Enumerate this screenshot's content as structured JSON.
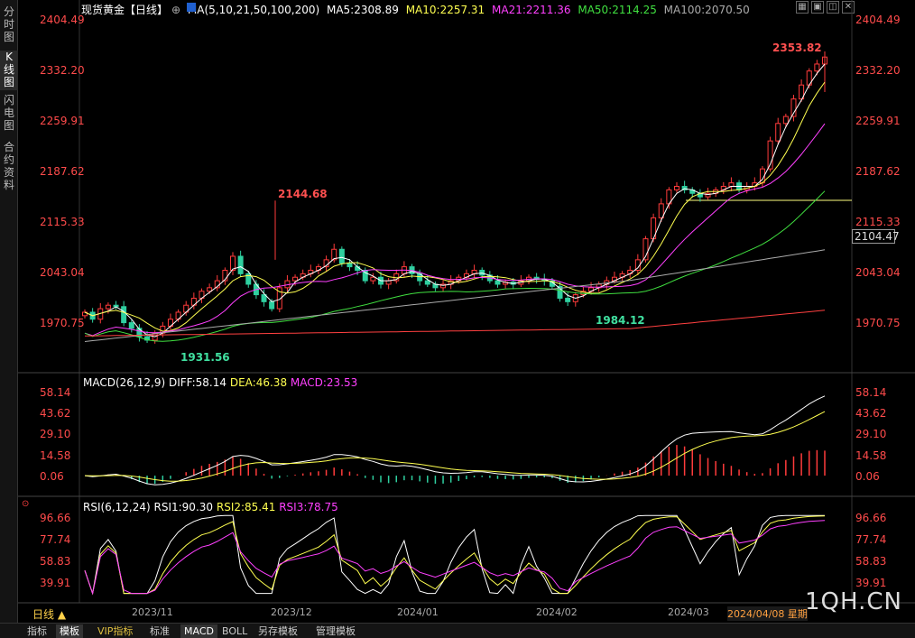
{
  "left_tabs": [
    {
      "label": "分\n时\n图",
      "active": false
    },
    {
      "label": "K\n线\n图",
      "active": true
    },
    {
      "label": "闪\n电\n图",
      "active": false
    },
    {
      "label": "合\n约\n资\n料",
      "active": false
    }
  ],
  "header": {
    "title": "现货黄金【日线】",
    "ma_params": "MA(5,10,21,50,100,200)",
    "ma5": "MA5:2308.89",
    "ma10": "MA10:2257.31",
    "ma21": "MA21:2211.36",
    "ma50": "MA50:2114.25",
    "ma100": "MA100:2070.50"
  },
  "colors": {
    "up": "#ff3b3b",
    "down": "#2fd0a0",
    "ma5": "#ffffff",
    "ma10": "#ffff50",
    "ma21": "#ff40ff",
    "ma50": "#40e040",
    "ma100": "#aaaaaa",
    "ma200": "#ff4040",
    "hline": "#ffff80"
  },
  "price_axis": [
    "2404.49",
    "2332.20",
    "2259.91",
    "2187.62",
    "2115.33",
    "2043.04",
    "1970.75"
  ],
  "current_price": "2104.47",
  "annotations": {
    "high1": "2144.68",
    "low1": "1931.56",
    "low2": "1984.12",
    "high2": "2353.82"
  },
  "macd": {
    "title": "MACD(26,12,9)",
    "diff": "DIFF:58.14",
    "dea": "DEA:46.38",
    "macd": "MACD:23.53",
    "axis": [
      "58.14",
      "43.62",
      "29.10",
      "14.58",
      "0.06"
    ]
  },
  "rsi": {
    "title": "RSI(6,12,24)",
    "rsi1": "RSI1:90.30",
    "rsi2": "RSI2:85.41",
    "rsi3": "RSI3:78.75",
    "axis": [
      "96.66",
      "77.74",
      "58.83",
      "39.91"
    ]
  },
  "dates": [
    "2023/11",
    "2023/12",
    "2024/01",
    "2024/02",
    "2024/03"
  ],
  "cursor_date": "2024/04/08 星期",
  "period_label": "日线 ▲",
  "watermark": "1QH.CN",
  "bottom_tabs": [
    {
      "label": "指标",
      "active": false,
      "vip": false
    },
    {
      "label": "模板",
      "active": true,
      "vip": false
    },
    {
      "label": "VIP指标",
      "active": false,
      "vip": true
    },
    {
      "label": "标准",
      "active": false,
      "vip": false
    },
    {
      "label": "MACD",
      "active": true,
      "vip": false
    },
    {
      "label": "BOLL",
      "active": false,
      "vip": false
    },
    {
      "label": "另存模板",
      "active": false,
      "vip": false
    },
    {
      "label": "管理模板",
      "active": false,
      "vip": false
    }
  ],
  "chart_data": {
    "type": "candlestick",
    "price_range": [
      1931.56,
      2404.49
    ],
    "dates": [
      "2023/11",
      "2023/12",
      "2024/01",
      "2024/02",
      "2024/03",
      "2024/04/08"
    ],
    "close_path": [
      1985,
      1975,
      1990,
      1995,
      1993,
      1970,
      1962,
      1950,
      1945,
      1955,
      1965,
      1975,
      1985,
      1995,
      2005,
      2015,
      2020,
      2030,
      2045,
      2065,
      2040,
      2025,
      2010,
      2000,
      1990,
      2020,
      2030,
      2035,
      2040,
      2045,
      2050,
      2060,
      2075,
      2055,
      2050,
      2045,
      2030,
      2035,
      2025,
      2030,
      2040,
      2050,
      2040,
      2030,
      2025,
      2020,
      2025,
      2030,
      2035,
      2040,
      2045,
      2038,
      2030,
      2025,
      2028,
      2025,
      2030,
      2035,
      2032,
      2030,
      2022,
      2005,
      2000,
      2010,
      2015,
      2020,
      2025,
      2030,
      2035,
      2040,
      2045,
      2060,
      2090,
      2120,
      2140,
      2160,
      2165,
      2160,
      2155,
      2150,
      2155,
      2160,
      2165,
      2170,
      2160,
      2165,
      2170,
      2190,
      2230,
      2255,
      2265,
      2290,
      2310,
      2330,
      2340,
      2350
    ]
  }
}
